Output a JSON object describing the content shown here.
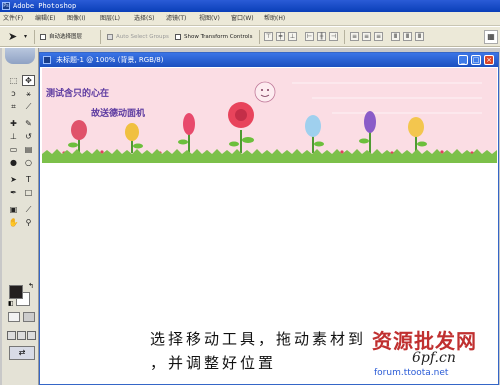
{
  "app": {
    "title": "Adobe Photoshop",
    "icon_text": "Ps"
  },
  "menu": [
    "文件(F)",
    "编辑(E)",
    "图像(I)",
    "图层(L)",
    "选择(S)",
    "滤镜(T)",
    "视图(V)",
    "窗口(W)",
    "帮助(H)"
  ],
  "options": {
    "tool_icon": "move-arrow",
    "auto_select_layer": "自动选择图层",
    "auto_select_groups": "Auto Select Groups",
    "show_transform_controls": "Show Transform Controls"
  },
  "document": {
    "title": "未标题-1 @ 100% (背景, RGB/8)",
    "minimize": "_",
    "maximize": "□",
    "close": "×"
  },
  "banner": {
    "line1": "测试含只的心在",
    "line2": "故送德动面机"
  },
  "caption": {
    "line1": "选择移动工具，拖动素材到",
    "line2": "，并调整好位置"
  },
  "watermark": {
    "chars": "资源批发网",
    "site": "6pf.cn",
    "forum": "forum.ttoota.net"
  },
  "colors": {
    "titlebar": "#0a3fb8",
    "banner_bg": "#fbdde4",
    "grass": "#7cc04a",
    "foreground_swatch": "#231f1f",
    "watermark_red": "#c03030"
  }
}
